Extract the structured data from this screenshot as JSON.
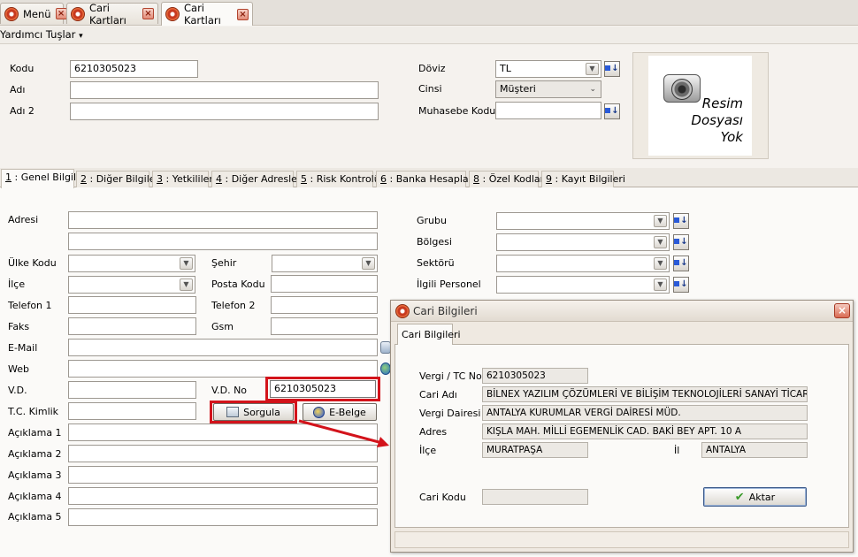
{
  "tabs": [
    {
      "label": "Menü"
    },
    {
      "label": "Cari Kartları"
    },
    {
      "label": "Cari Kartları"
    }
  ],
  "menu": {
    "label": "Yardımcı Tuşlar",
    "arrow": "▾"
  },
  "header": {
    "kodu_label": "Kodu",
    "kodu_value": "6210305023",
    "adi_label": "Adı",
    "adi_value": "",
    "adi2_label": "Adı 2",
    "adi2_value": "",
    "doviz_label": "Döviz",
    "doviz_value": "TL",
    "cinsi_label": "Cinsi",
    "cinsi_value": "Müşteri",
    "muhasebe_label": "Muhasebe Kodu",
    "muhasebe_value": ""
  },
  "photo": {
    "line1": "Resim",
    "line2": "Dosyası",
    "line3": "Yok",
    "icon": "camera-icon"
  },
  "inner_tabs": [
    {
      "num": "1",
      "label": " : Genel Bilgiler"
    },
    {
      "num": "2",
      "label": " : Diğer Bilgiler"
    },
    {
      "num": "3",
      "label": " : Yetkililer"
    },
    {
      "num": "4",
      "label": " : Diğer Adresler"
    },
    {
      "num": "5",
      "label": " : Risk Kontrolü"
    },
    {
      "num": "6",
      "label": " : Banka Hesapları"
    },
    {
      "num": "8",
      "label": " : Özel Kodlar"
    },
    {
      "num": "9",
      "label": " : Kayıt Bilgileri"
    }
  ],
  "form": {
    "adresi": "Adresi",
    "ulke_kodu": "Ülke Kodu",
    "sehir": "Şehir",
    "ilce": "İlçe",
    "posta_kodu": "Posta Kodu",
    "telefon1": "Telefon 1",
    "telefon2": "Telefon 2",
    "faks": "Faks",
    "gsm": "Gsm",
    "email": "E-Mail",
    "web": "Web",
    "vd": "V.D.",
    "vd_no": "V.D. No",
    "vd_no_value": "6210305023",
    "tc_kimlik": "T.C. Kimlik",
    "sorgula": "Sorgula",
    "ebelge": "E-Belge",
    "aciklama1": "Açıklama 1",
    "aciklama2": "Açıklama 2",
    "aciklama3": "Açıklama 3",
    "aciklama4": "Açıklama 4",
    "aciklama5": "Açıklama 5",
    "grubu": "Grubu",
    "bolgesi": "Bölgesi",
    "sektoru": "Sektörü",
    "ilgili_personel": "İlgili Personel"
  },
  "dialog": {
    "title": "Cari Bilgileri",
    "tab": "Cari Bilgileri",
    "vergi_label": "Vergi / TC No",
    "vergi_value": "6210305023",
    "cari_adi_label": "Cari Adı",
    "cari_adi_value": "BİLNEX YAZILIM ÇÖZÜMLERİ VE BİLİŞİM TEKNOLOJİLERİ SANAYİ TİCARET LİMİTED ŞİRKETİ",
    "vergi_dairesi_label": "Vergi Dairesi",
    "vergi_dairesi_value": "ANTALYA KURUMLAR VERGİ DAİRESİ MÜD.",
    "adres_label": "Adres",
    "adres_value": "KIŞLA MAH.  MİLLİ EGEMENLİK CAD. BAKİ BEY APT. 10 A",
    "ilce_label": "İlçe",
    "ilce_value": "MURATPAŞA",
    "il_label": "İl",
    "il_value": "ANTALYA",
    "cari_kodu_label": "Cari Kodu",
    "cari_kodu_value": "",
    "aktar": "Aktar"
  },
  "colors": {
    "highlight": "#d3131b",
    "accent": "#2a5ad8"
  }
}
